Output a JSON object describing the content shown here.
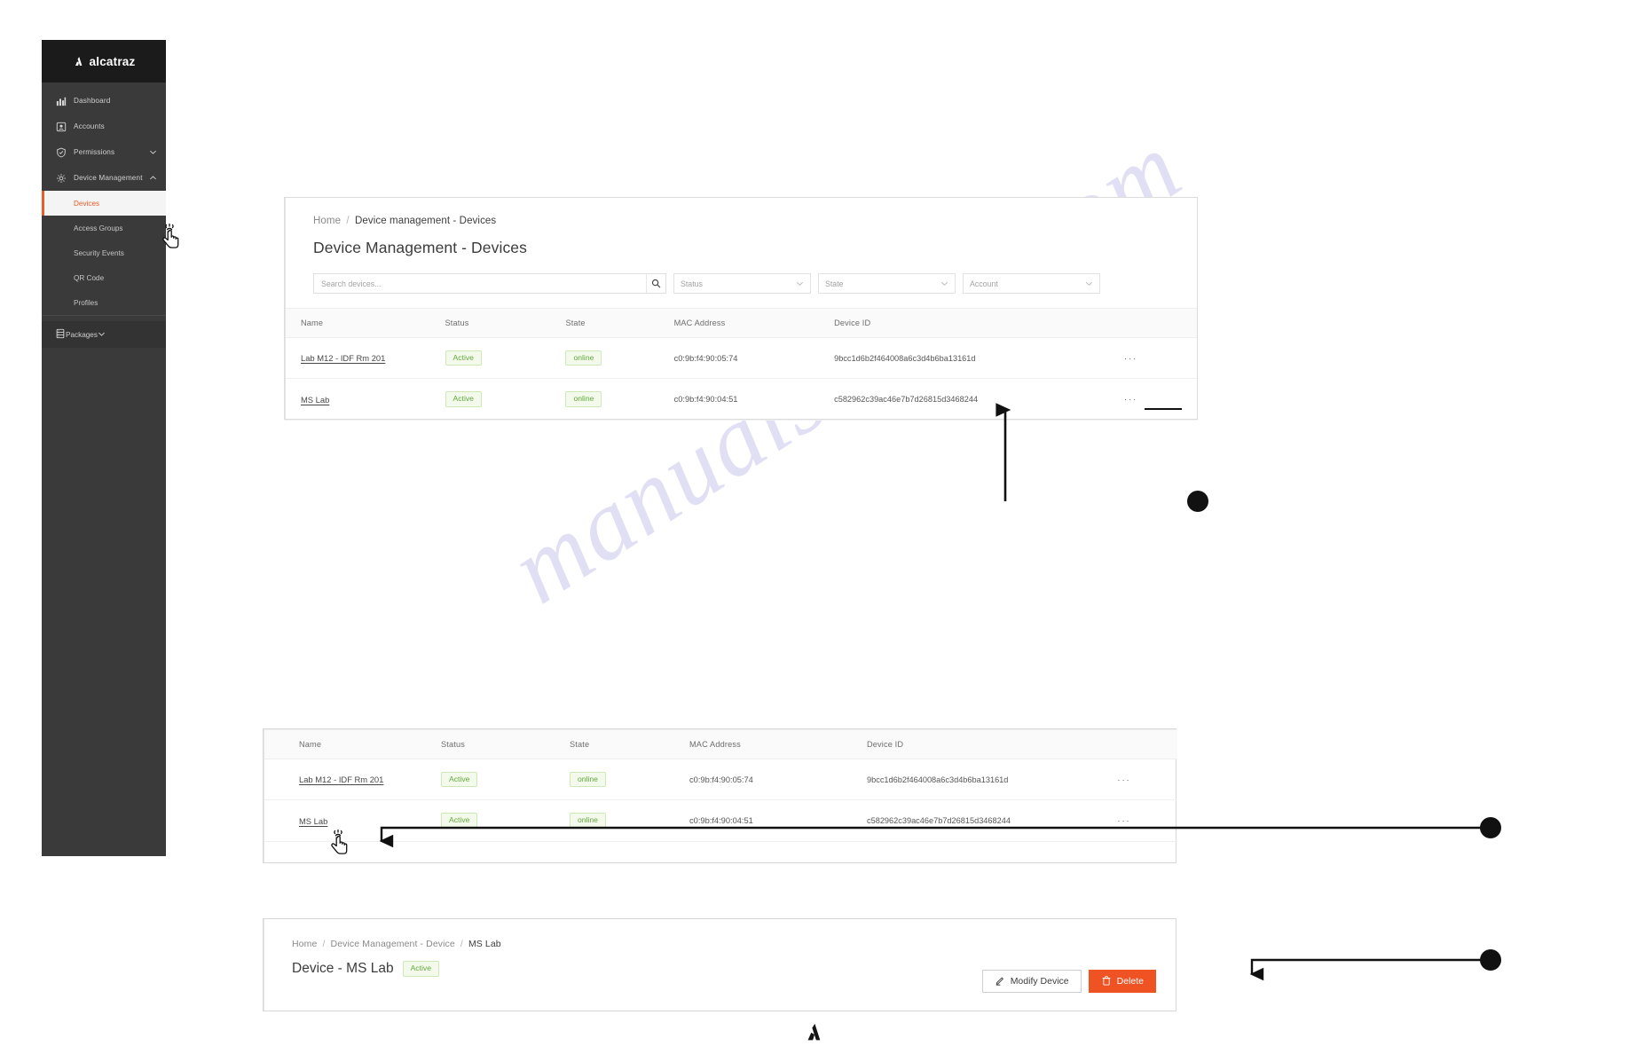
{
  "brand": {
    "name": "alcatraz",
    "logo_icon": "alcatraz-a-logo",
    "accent_color": "#ec5b29",
    "sidebar_bg": "#3a3a3a"
  },
  "sidebar": {
    "items": [
      {
        "label": "Dashboard",
        "icon": "bar-chart-icon",
        "expandable": false,
        "active": false
      },
      {
        "label": "Accounts",
        "icon": "account-card-icon",
        "expandable": false,
        "active": false
      },
      {
        "label": "Permissions",
        "icon": "shield-check-icon",
        "expandable": true,
        "chevron": "chevron-down-icon",
        "active": false
      },
      {
        "label": "Device Management",
        "icon": "gear-icon",
        "expandable": true,
        "chevron": "chevron-up-icon",
        "active": false
      }
    ],
    "subitems": [
      {
        "label": "Devices",
        "active": true
      },
      {
        "label": "Access Groups",
        "active": false
      },
      {
        "label": "Security Events",
        "active": false
      },
      {
        "label": "QR Code",
        "active": false
      },
      {
        "label": "Profiles",
        "active": false
      }
    ],
    "footer_item": {
      "label": "Packages",
      "icon": "server-stack-icon",
      "chevron": "chevron-down-icon"
    }
  },
  "devices_page": {
    "breadcrumb": {
      "home": "Home",
      "separator": "/",
      "current": "Device management - Devices"
    },
    "title": "Device Management - Devices",
    "search": {
      "placeholder": "Search devices...",
      "value": "",
      "icon": "search-icon"
    },
    "filters": [
      {
        "label": "Status",
        "icon": "chevron-down-icon"
      },
      {
        "label": "State",
        "icon": "chevron-down-icon"
      },
      {
        "label": "Account",
        "icon": "chevron-down-icon"
      }
    ],
    "table": {
      "columns": [
        "Name",
        "Status",
        "State",
        "MAC Address",
        "Device ID",
        ""
      ],
      "rows": [
        {
          "name": "Lab M12 - IDF Rm 201",
          "status": "Active",
          "state": "online",
          "mac": "c0:9b:f4:90:05:74",
          "device_id": "9bcc1d6b2f464008a6c3d4b6ba13161d",
          "actions": "···"
        },
        {
          "name": "MS Lab",
          "status": "Active",
          "state": "online",
          "mac": "c0:9b:f4:90:04:51",
          "device_id": "c582962c39ac46e7b7d26815d3468244",
          "actions": "···"
        }
      ]
    }
  },
  "table_panel_2": {
    "columns": [
      "Name",
      "Status",
      "State",
      "MAC Address",
      "Device ID",
      ""
    ],
    "rows": [
      {
        "name": "Lab M12 - IDF Rm 201",
        "status": "Active",
        "state": "online",
        "mac": "c0:9b:f4:90:05:74",
        "device_id": "9bcc1d6b2f464008a6c3d4b6ba13161d",
        "actions": "···"
      },
      {
        "name": "MS Lab",
        "status": "Active",
        "state": "online",
        "mac": "c0:9b:f4:90:04:51",
        "device_id": "c582962c39ac46e7b7d26815d3468244",
        "actions": "···"
      }
    ]
  },
  "device_detail": {
    "breadcrumb": {
      "home": "Home",
      "sep1": "/",
      "section": "Device Management - Device",
      "sep2": "/",
      "current": "MS Lab"
    },
    "title": "Device - MS Lab",
    "status_badge": "Active",
    "buttons": {
      "modify": {
        "label": "Modify Device",
        "icon": "pencil-icon"
      },
      "delete": {
        "label": "Delete",
        "icon": "trash-icon",
        "color": "#ef5223"
      }
    }
  },
  "annotations": {
    "markers": [
      {
        "id": "marker-1",
        "target": "device-id-cell-row1"
      },
      {
        "id": "marker-2",
        "target": "ms-lab-name-link"
      },
      {
        "id": "marker-3",
        "target": "modify-device-button"
      }
    ],
    "cursors": [
      {
        "id": "cursor-sidebar-devices"
      },
      {
        "id": "cursor-ms-lab-link"
      }
    ]
  },
  "watermark": {
    "text": "manualshive . com"
  },
  "footer": {
    "logo_icon": "alcatraz-a-logo"
  }
}
